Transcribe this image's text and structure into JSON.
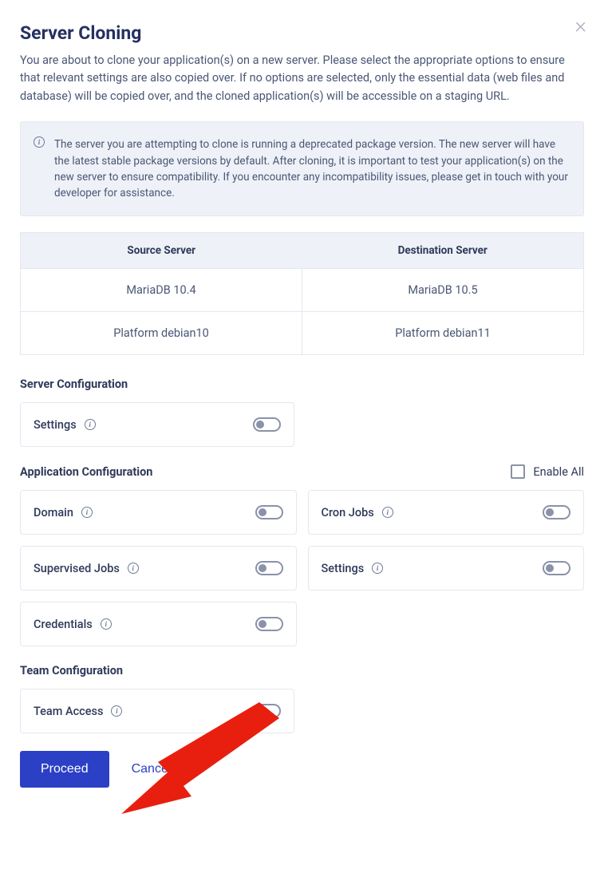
{
  "modal": {
    "title": "Server Cloning",
    "subtitle": "You are about to clone your application(s) on a new server. Please select the appropriate options to ensure that relevant settings are also copied over. If no options are selected, only the essential data (web files and database) will be copied over, and the cloned application(s) will be accessible on a staging URL.",
    "warning": "The server you are attempting to clone is running a deprecated package version. The new server will have the latest stable package versions by default. After cloning, it is important to test your application(s) on the new server to ensure compatibility. If you encounter any incompatibility issues, please get in touch with your developer for assistance."
  },
  "table": {
    "headers": {
      "source": "Source Server",
      "destination": "Destination Server"
    },
    "rows": [
      {
        "source": "MariaDB 10.4",
        "destination": "MariaDB 10.5"
      },
      {
        "source": "Platform debian10",
        "destination": "Platform debian11"
      }
    ]
  },
  "sections": {
    "server_config": {
      "heading": "Server Configuration",
      "items": {
        "settings": "Settings"
      }
    },
    "app_config": {
      "heading": "Application Configuration",
      "enable_all": "Enable All",
      "items": {
        "domain": "Domain",
        "cron_jobs": "Cron Jobs",
        "supervised_jobs": "Supervised Jobs",
        "settings": "Settings",
        "credentials": "Credentials"
      }
    },
    "team_config": {
      "heading": "Team Configuration",
      "items": {
        "team_access": "Team Access"
      }
    }
  },
  "actions": {
    "proceed": "Proceed",
    "cancel": "Cancel"
  }
}
